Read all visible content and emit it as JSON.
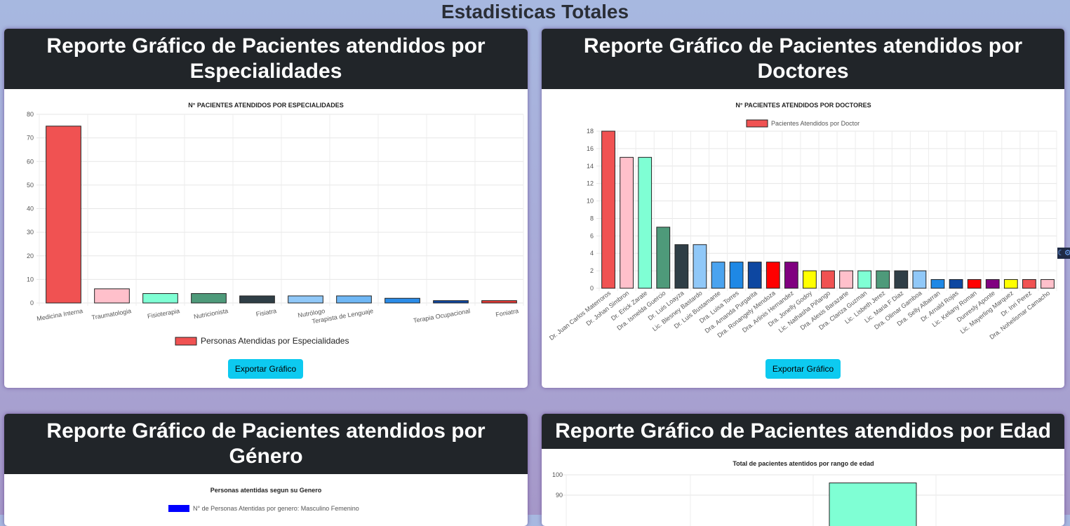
{
  "page": {
    "title": "Estadisticas Totales"
  },
  "cards": {
    "especialidades": {
      "header": "Reporte Gráfico de Pacientes atendidos por Especialidades",
      "export_label": "Exportar Gráfico"
    },
    "doctores": {
      "header": "Reporte Gráfico de Pacientes atendidos por Doctores",
      "export_label": "Exportar Gráfico"
    },
    "genero": {
      "header": "Reporte Gráfico de Pacientes atendidos por Género"
    },
    "edad": {
      "header": "Reporte Gráfico de Pacientes atendidos por Edad"
    }
  },
  "chart_data": [
    {
      "id": "especialidades",
      "type": "bar",
      "title": "N° PACIENTES ATENDIDOS POR ESPECIALIDADES",
      "legend": "Personas Atendidas por Especialidades",
      "legend_position": "bottom",
      "categories": [
        "Medicina Interna",
        "Traumatologia",
        "Fisioterapia",
        "Nutricionista",
        "Fisiatra",
        "Nutrólogo",
        "Terapista de Lenguaje",
        "",
        "Terapia Ocupacional",
        "Foniatra"
      ],
      "values": [
        75,
        6,
        4,
        4,
        3,
        3,
        3,
        2,
        1,
        1
      ],
      "colors": [
        "#f05252",
        "#ffc0cb",
        "#7fffd4",
        "#4e9a7a",
        "#2f3e46",
        "#90c8f8",
        "#6fb7f5",
        "#2b8ce8",
        "#0d47a1",
        "#e53935"
      ],
      "ylim": [
        0,
        80
      ],
      "yticks": [
        0,
        10,
        20,
        30,
        40,
        50,
        60,
        70,
        80
      ],
      "grid": true
    },
    {
      "id": "doctores",
      "type": "bar",
      "title": "N° PACIENTES ATENDIDOS POR DOCTORES",
      "legend": "Pacientes Atendidos por Doctor",
      "legend_position": "top",
      "categories": [
        "Dr. Juan Carlos Materroros",
        "Dr. Johan Simbron",
        "Dr. Erick Zarate",
        "Dra. Ismelda Guercio",
        "Dr. Luis Loayza",
        "Lic. Blesney Bastardo",
        "Dr. Luis Bustamante",
        "Dra. Luisa Torres",
        "Dra. Amanda Purgarita",
        "Dra. Ronangely Mendoza",
        "Dra. Arlinis Hernandez",
        "Dra. Jonelly Godoy",
        "Lic. Nathasha Piñango",
        "Dra. Alexis Barazarte",
        "Dra. Clariza Guzman",
        "Lic. Lisbeth Jerez",
        "Lic. Maria F Diaz",
        "Dra. Olimar Gamboa",
        "Dra. Selly Albarran",
        "Dr. Arnald Rojas",
        "Lic. Keliany Roman",
        "Dunresly Aponte",
        "Lic. Mayerling Marquez",
        "Dr. Inri Perez",
        "Dra. Nohelismar Camacho"
      ],
      "values": [
        18,
        15,
        15,
        7,
        5,
        5,
        3,
        3,
        3,
        3,
        3,
        2,
        2,
        2,
        2,
        2,
        2,
        2,
        1,
        1,
        1,
        1,
        1,
        1,
        1
      ],
      "colors": [
        "#f05252",
        "#ffc0cb",
        "#7fffd4",
        "#4e9a7a",
        "#2f3e46",
        "#90c8f8",
        "#4aa3ef",
        "#1e88e5",
        "#0d47a1",
        "#ff0000",
        "#800080",
        "#ffff00",
        "#f05252",
        "#ffc0cb",
        "#7fffd4",
        "#4e9a7a",
        "#2f3e46",
        "#90c8f8",
        "#1e88e5",
        "#0d47a1",
        "#ff0000",
        "#800080",
        "#ffff00",
        "#f05252",
        "#ffc0cb"
      ],
      "ylim": [
        0,
        18
      ],
      "yticks": [
        0,
        2,
        4,
        6,
        8,
        10,
        12,
        14,
        16,
        18
      ],
      "grid": true
    },
    {
      "id": "genero",
      "type": "bar",
      "title": "Personas atentidas segun su Genero",
      "legend": "N° de Personas Atentidas por genero:  Masculino  Femenino",
      "legend_position": "top",
      "legend_color": "#0000ff"
    },
    {
      "id": "edad",
      "type": "bar",
      "title": "Total de pacientes atentidos por rango de edad",
      "ylim": [
        80,
        100
      ],
      "yticks": [
        90,
        100
      ],
      "visible_bar": {
        "value": 96,
        "color": "#7fffd4"
      }
    }
  ]
}
